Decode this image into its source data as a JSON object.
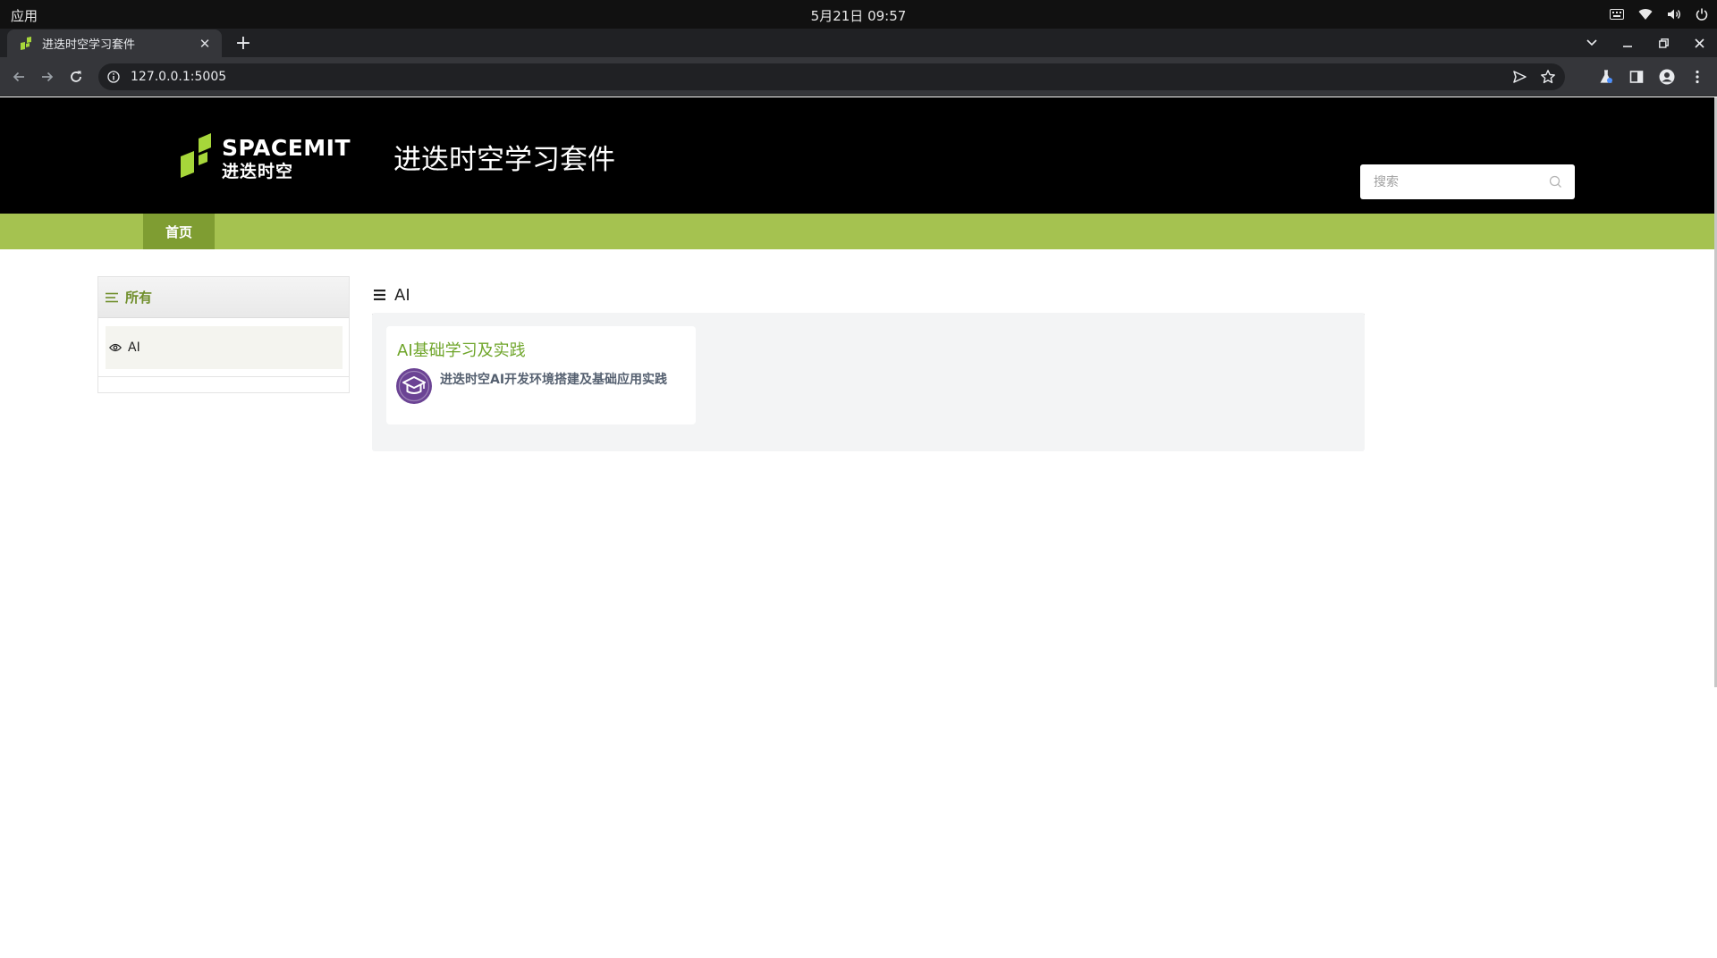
{
  "os_bar": {
    "apps_label": "应用",
    "clock": "5月21日  09:57"
  },
  "browser": {
    "tab": {
      "title": "进迭时空学习套件"
    },
    "address": {
      "url": "127.0.0.1:5005"
    }
  },
  "site": {
    "logo": {
      "brand": "SPACEMIT",
      "brand_cn": "进迭时空"
    },
    "title": "进迭时空学习套件",
    "search": {
      "placeholder": "搜索"
    },
    "nav": {
      "home": "首页"
    }
  },
  "sidebar": {
    "header": "所有",
    "items": [
      {
        "label": "AI"
      }
    ]
  },
  "content": {
    "heading": "AI",
    "courses": [
      {
        "title": "AI基础学习及实践",
        "description": "进迭时空AI开发环境搭建及基础应用实践",
        "icon": "graduation-cap-icon"
      }
    ]
  },
  "colors": {
    "header_bg": "#000000",
    "nav_green": "#a5c250",
    "nav_active": "#7f9d32",
    "accent_green": "#6fa52a",
    "course_icon": "#6b4394"
  }
}
